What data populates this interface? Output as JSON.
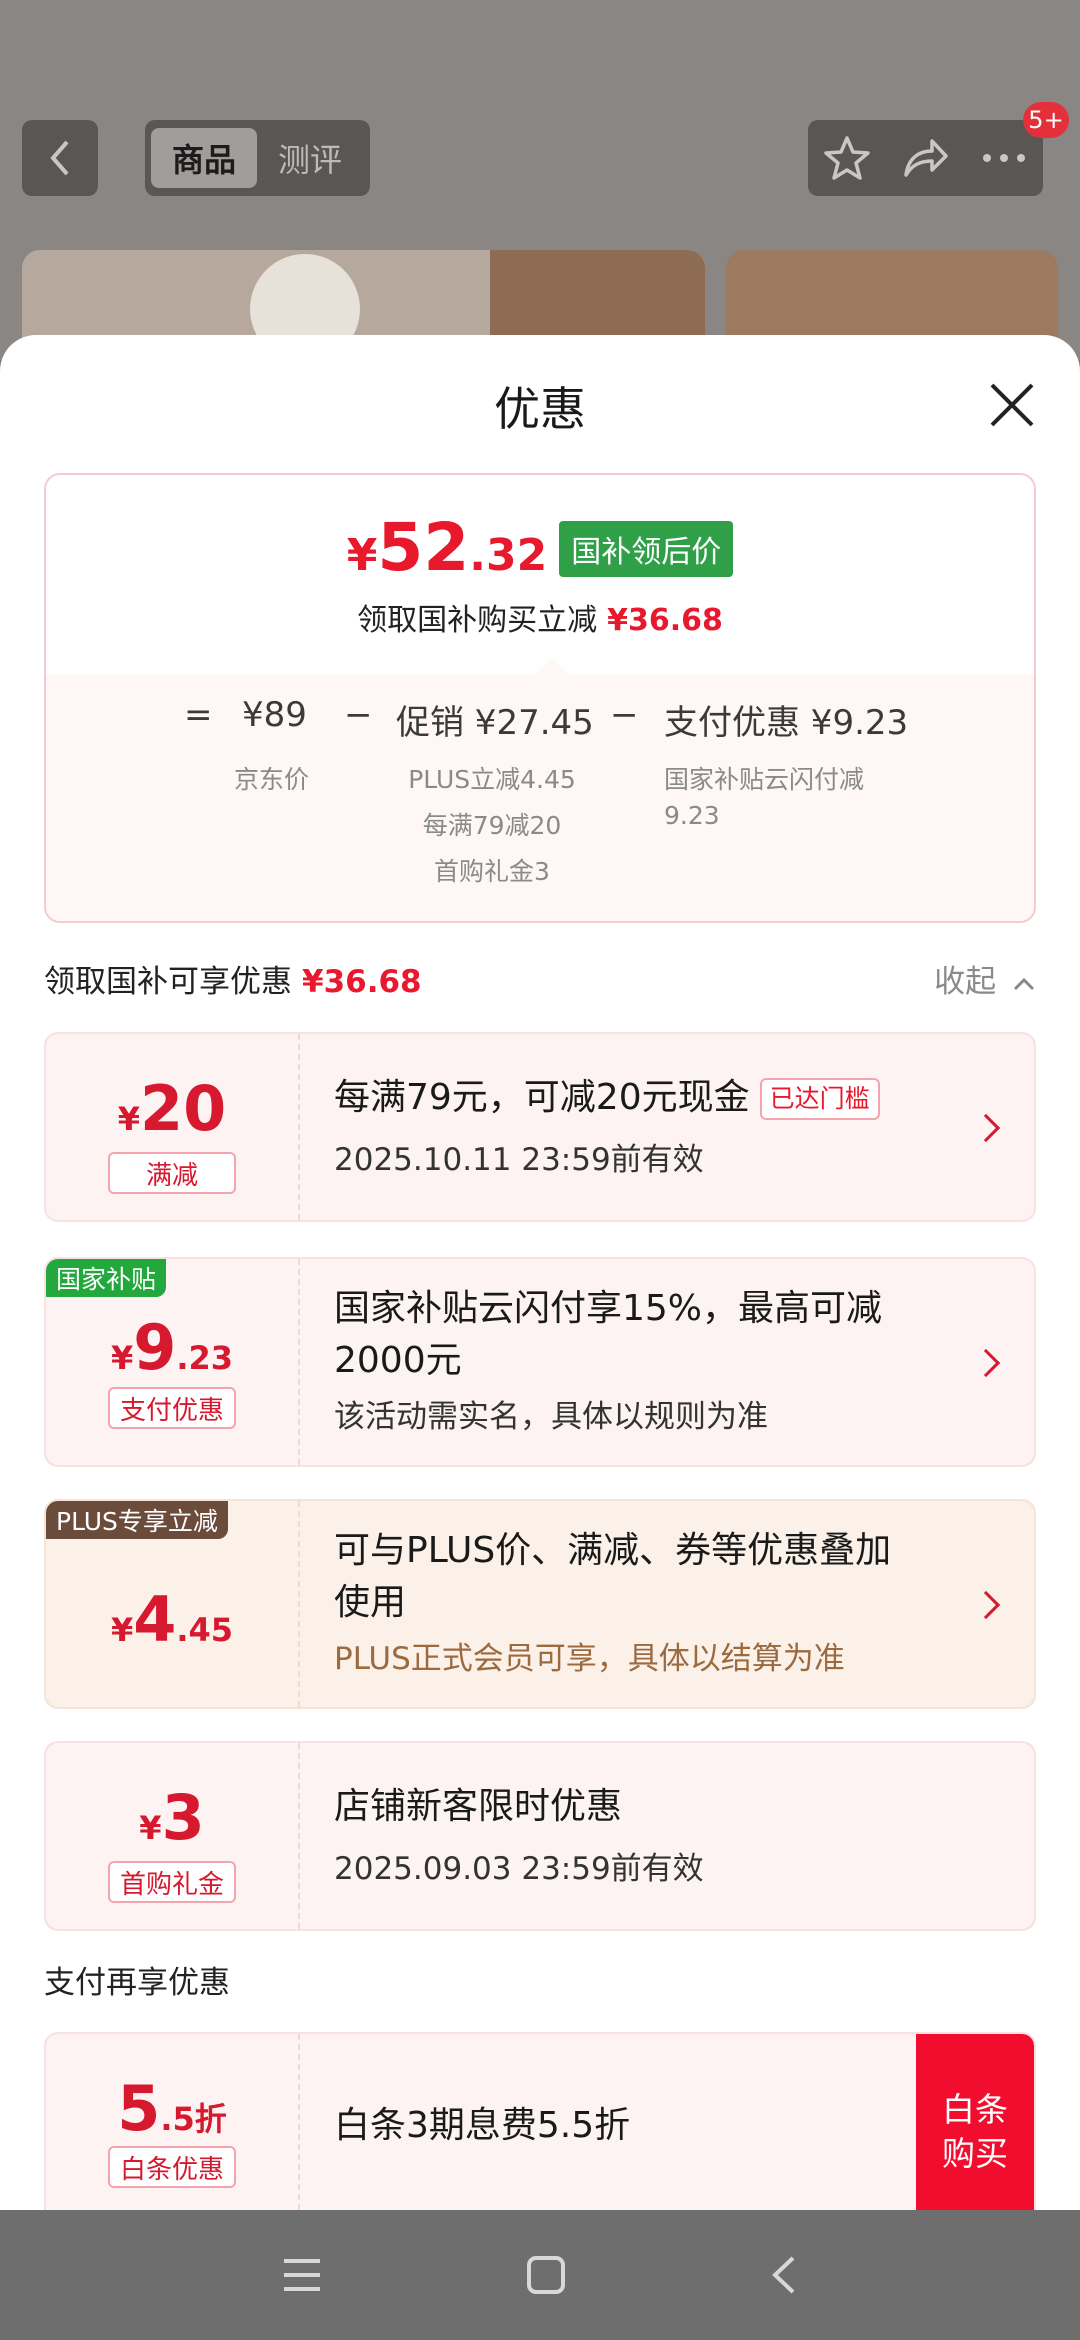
{
  "background": {
    "tabs": [
      "商品",
      "测评"
    ],
    "active_tab": "商品",
    "badge": "5+"
  },
  "sheet": {
    "title": "优惠"
  },
  "summary": {
    "price_yen": "¥",
    "price_int": "52",
    "price_dec": ".32",
    "price_tag": "国补领后价",
    "sub_text": "领取国补购买立减",
    "sub_amount": "¥36.68",
    "eq": "=",
    "jd_price": "¥89",
    "minus1": "−",
    "promo": "促销 ¥27.45",
    "minus2": "−",
    "pay_discount": "支付优惠 ¥9.23",
    "jd_label": "京东价",
    "promo_notes": [
      "PLUS立减4.45",
      "每满79减20",
      "首购礼金3"
    ],
    "pay_notes": [
      "国家补贴云闪付减",
      "9.23"
    ]
  },
  "section1": {
    "title": "领取国补可享优惠",
    "amount": "¥36.68",
    "collapse": "收起"
  },
  "coupons": [
    {
      "yen": "¥",
      "big": "20",
      "small": "",
      "tag": "满减",
      "title": "每满79元，可减20元现金",
      "badge": "已达门槛",
      "sub": "2025.10.11 23:59前有效"
    },
    {
      "corner": "国家补贴",
      "yen": "¥",
      "big": "9",
      "small": ".23",
      "tag": "支付优惠",
      "title1": "国家补贴云闪付享15%，最高可减",
      "title2": "2000元",
      "sub": "该活动需实名，具体以规则为准"
    },
    {
      "corner": "PLUS专享立减",
      "yen": "¥",
      "big": "4",
      "small": ".45",
      "title1": "可与PLUS价、满减、券等优惠叠加",
      "title2": "使用",
      "sub": "PLUS正式会员可享，具体以结算为准"
    },
    {
      "yen": "¥",
      "big": "3",
      "small": "",
      "tag": "首购礼金",
      "title": "店铺新客限时优惠",
      "sub": "2025.09.03 23:59前有效"
    }
  ],
  "section2": {
    "title": "支付再享优惠"
  },
  "baitiao": {
    "big": "5",
    "small": ".5折",
    "tag": "白条优惠",
    "title": "白条3期息费5.5折",
    "button": "白条购买"
  },
  "colors": {
    "accent_red": "#e8182d",
    "green": "#2fa048",
    "plus_brown": "#6b4b3a"
  }
}
